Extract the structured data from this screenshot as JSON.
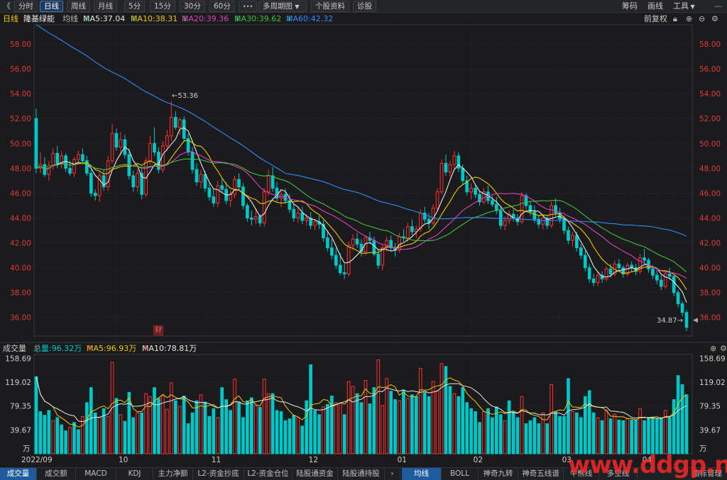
{
  "toolbar": {
    "back_glyph": "《",
    "periods": [
      "分时",
      "日线",
      "周线",
      "月线",
      "5分",
      "15分",
      "30分",
      "60分"
    ],
    "active_period": "日线",
    "more_glyph": "•••",
    "multi_period": "多周期图",
    "profile": "个股资料",
    "diagnose": "诊股",
    "right": [
      "筹码",
      "画线",
      "工具"
    ]
  },
  "info": {
    "period": "日线",
    "name": "隆基绿能",
    "ma_label": "均线",
    "ma": [
      {
        "text": "MA5:37.04",
        "arrow": "↓",
        "color": "#e8e8e8",
        "arrow_color": "#2ec27e"
      },
      {
        "text": "MA10:38.31",
        "arrow": "↓",
        "color": "#f0c800",
        "arrow_color": "#2ec27e"
      },
      {
        "text": "MA20:39.36",
        "arrow": "↓",
        "color": "#e040c0",
        "arrow_color": "#2ec27e"
      },
      {
        "text": "MA30:39.62",
        "arrow": "↓",
        "color": "#40c040",
        "arrow_color": "#2ec27e"
      },
      {
        "text": "MA60:42.32",
        "arrow": "↓",
        "color": "#2a8cff",
        "arrow_color": "#2ec27e"
      }
    ],
    "adjust": "前复权"
  },
  "price_axis": {
    "labels": [
      "58.00",
      "56.00",
      "54.00",
      "52.00",
      "50.00",
      "48.00",
      "46.00",
      "44.00",
      "42.00",
      "40.00",
      "38.00",
      "36.00"
    ],
    "min": 34.5,
    "max": 58.8
  },
  "high_marker": "53.36",
  "low_marker": "34.87",
  "fin_badge": "财",
  "volume": {
    "label": "成交量",
    "total": "总量:96.32万",
    "total_arrow": "↑",
    "ma5": "MA5:96.93万",
    "ma5_arrow": "↑",
    "ma10": "MA10:78.81万",
    "ma10_arrow": "↑",
    "axis": [
      "158.69",
      "119.02",
      "79.35",
      "39.67"
    ],
    "unit": "万",
    "max": 165
  },
  "x_axis": [
    "2022/09",
    "10",
    "11",
    "12",
    "01",
    "02",
    "03",
    "04"
  ],
  "bottom_tabs_left": [
    "成交量",
    "成交额",
    "MACD",
    "KDJ",
    "主力净额",
    "L2-资金抄底",
    "L2-资金仓位",
    "陆股通资金",
    "陆股通持股"
  ],
  "bottom_tabs_right": [
    "均线",
    "BOLL",
    "神奇九转",
    "神奇五线谱",
    "牛熊线",
    "多空线"
  ],
  "bottom_right": "指标管理",
  "watermark": "www.ddgp.net",
  "colors": {
    "up": "#ff3030",
    "down": "#00c8c8",
    "ma5": "#e8e8e8",
    "ma10": "#f0c800",
    "ma20": "#e040c0",
    "ma30": "#40c040",
    "ma60": "#2a8cff",
    "text_red": "#e03a3a"
  },
  "chart_data": {
    "type": "candlestick",
    "title": "隆基绿能",
    "note": "Daily candlesticks (前复权), approximately read from the screenshot",
    "candles": [
      [
        52.0,
        52.8,
        47.6,
        48.0
      ],
      [
        48.0,
        49.3,
        47.6,
        48.3
      ],
      [
        48.3,
        48.9,
        47.3,
        47.5
      ],
      [
        47.5,
        48.6,
        47.0,
        48.2
      ],
      [
        48.2,
        49.6,
        47.9,
        49.2
      ],
      [
        49.2,
        49.8,
        48.0,
        48.4
      ],
      [
        48.4,
        49.4,
        48.0,
        49.0
      ],
      [
        49.0,
        49.2,
        47.7,
        48.0
      ],
      [
        48.0,
        48.6,
        47.4,
        47.6
      ],
      [
        47.6,
        48.9,
        47.3,
        48.7
      ],
      [
        48.7,
        49.4,
        48.3,
        49.1
      ],
      [
        49.1,
        49.6,
        48.4,
        48.6
      ],
      [
        48.6,
        49.0,
        47.4,
        47.6
      ],
      [
        47.6,
        47.9,
        45.7,
        46.0
      ],
      [
        46.0,
        46.3,
        45.4,
        45.8
      ],
      [
        45.8,
        47.7,
        45.3,
        47.4
      ],
      [
        47.4,
        47.9,
        46.2,
        46.5
      ],
      [
        46.5,
        49.0,
        46.2,
        48.6
      ],
      [
        48.6,
        51.6,
        48.4,
        50.8
      ],
      [
        50.8,
        51.2,
        49.4,
        49.7
      ],
      [
        49.7,
        50.9,
        49.0,
        50.3
      ],
      [
        50.3,
        50.7,
        48.8,
        49.1
      ],
      [
        49.1,
        49.6,
        47.1,
        47.4
      ],
      [
        47.4,
        47.8,
        46.1,
        46.5
      ],
      [
        46.5,
        47.9,
        46.1,
        47.6
      ],
      [
        47.6,
        48.1,
        45.5,
        45.9
      ],
      [
        45.9,
        48.9,
        45.7,
        48.6
      ],
      [
        48.6,
        50.6,
        48.3,
        50.0
      ],
      [
        50.0,
        51.3,
        49.0,
        49.3
      ],
      [
        49.3,
        49.7,
        47.6,
        47.9
      ],
      [
        47.9,
        50.2,
        47.6,
        49.8
      ],
      [
        49.8,
        51.1,
        49.4,
        50.6
      ],
      [
        50.6,
        53.4,
        50.2,
        52.1
      ],
      [
        52.1,
        52.6,
        51.1,
        51.3
      ],
      [
        51.3,
        52.1,
        50.7,
        51.9
      ],
      [
        51.9,
        52.2,
        50.1,
        50.4
      ],
      [
        50.4,
        50.8,
        49.0,
        49.3
      ],
      [
        49.3,
        49.7,
        47.6,
        47.9
      ],
      [
        47.9,
        48.4,
        46.6,
        46.9
      ],
      [
        46.9,
        47.9,
        46.4,
        47.5
      ],
      [
        47.5,
        47.8,
        46.1,
        46.4
      ],
      [
        46.4,
        46.8,
        45.4,
        45.7
      ],
      [
        45.7,
        46.4,
        44.9,
        45.2
      ],
      [
        45.2,
        47.0,
        44.9,
        46.6
      ],
      [
        46.6,
        47.2,
        46.0,
        46.3
      ],
      [
        46.3,
        46.9,
        45.1,
        45.4
      ],
      [
        45.4,
        46.2,
        44.9,
        45.9
      ],
      [
        45.9,
        47.4,
        45.6,
        47.1
      ],
      [
        47.1,
        47.6,
        46.2,
        46.5
      ],
      [
        46.5,
        46.8,
        44.7,
        45.0
      ],
      [
        45.0,
        45.2,
        43.7,
        44.0
      ],
      [
        44.0,
        44.6,
        43.4,
        43.9
      ],
      [
        43.9,
        44.6,
        43.5,
        44.1
      ],
      [
        44.1,
        44.3,
        43.3,
        43.6
      ],
      [
        43.6,
        46.4,
        43.3,
        46.1
      ],
      [
        46.1,
        47.9,
        45.8,
        47.4
      ],
      [
        47.4,
        48.1,
        46.1,
        46.4
      ],
      [
        46.4,
        46.9,
        45.3,
        45.6
      ],
      [
        45.6,
        46.2,
        44.9,
        45.9
      ],
      [
        45.9,
        46.4,
        45.1,
        45.4
      ],
      [
        45.4,
        45.9,
        44.4,
        44.7
      ],
      [
        44.7,
        45.1,
        43.7,
        44.0
      ],
      [
        44.0,
        44.8,
        43.6,
        44.4
      ],
      [
        44.4,
        44.9,
        43.5,
        43.8
      ],
      [
        43.8,
        44.3,
        43.4,
        44.0
      ],
      [
        44.0,
        44.5,
        43.1,
        43.4
      ],
      [
        43.4,
        43.9,
        43.0,
        43.7
      ],
      [
        43.7,
        44.2,
        43.1,
        43.5
      ],
      [
        43.5,
        43.8,
        42.1,
        42.4
      ],
      [
        42.4,
        43.0,
        41.3,
        41.6
      ],
      [
        41.6,
        42.3,
        40.7,
        41.0
      ],
      [
        41.0,
        41.6,
        39.9,
        40.2
      ],
      [
        40.2,
        41.2,
        39.4,
        39.6
      ],
      [
        39.6,
        40.3,
        39.1,
        39.5
      ],
      [
        39.5,
        42.1,
        39.3,
        41.8
      ],
      [
        41.8,
        42.7,
        41.4,
        42.3
      ],
      [
        42.3,
        42.8,
        41.6,
        41.9
      ],
      [
        41.9,
        42.3,
        40.9,
        41.3
      ],
      [
        41.3,
        42.6,
        41.0,
        42.4
      ],
      [
        42.4,
        42.9,
        41.9,
        42.2
      ],
      [
        42.2,
        42.5,
        40.9,
        41.1
      ],
      [
        41.1,
        41.5,
        39.9,
        40.2
      ],
      [
        40.2,
        41.9,
        39.8,
        41.6
      ],
      [
        41.6,
        42.5,
        41.3,
        42.2
      ],
      [
        42.2,
        42.6,
        41.3,
        41.6
      ],
      [
        41.6,
        42.0,
        40.9,
        41.4
      ],
      [
        41.4,
        42.8,
        41.2,
        42.5
      ],
      [
        42.5,
        43.1,
        42.1,
        42.4
      ],
      [
        42.4,
        43.6,
        42.1,
        43.3
      ],
      [
        43.3,
        43.9,
        42.6,
        42.9
      ],
      [
        42.9,
        43.4,
        42.4,
        43.1
      ],
      [
        43.1,
        44.7,
        42.9,
        44.4
      ],
      [
        44.4,
        44.9,
        43.6,
        43.9
      ],
      [
        43.9,
        44.4,
        43.1,
        43.6
      ],
      [
        43.6,
        45.1,
        43.4,
        44.8
      ],
      [
        44.8,
        46.4,
        44.6,
        46.1
      ],
      [
        46.1,
        48.7,
        45.9,
        48.4
      ],
      [
        48.4,
        49.1,
        47.4,
        47.7
      ],
      [
        47.7,
        48.6,
        47.3,
        48.3
      ],
      [
        48.3,
        49.4,
        47.9,
        49.0
      ],
      [
        49.0,
        49.3,
        47.7,
        48.0
      ],
      [
        48.0,
        48.3,
        46.7,
        47.0
      ],
      [
        47.0,
        47.4,
        45.8,
        46.1
      ],
      [
        46.1,
        46.8,
        45.5,
        46.4
      ],
      [
        46.4,
        46.7,
        45.6,
        45.9
      ],
      [
        45.9,
        46.2,
        45.0,
        45.3
      ],
      [
        45.3,
        46.4,
        45.1,
        46.1
      ],
      [
        46.1,
        46.6,
        45.1,
        45.4
      ],
      [
        45.4,
        45.8,
        44.9,
        45.1
      ],
      [
        45.1,
        45.7,
        44.3,
        44.6
      ],
      [
        44.6,
        44.9,
        43.1,
        43.4
      ],
      [
        43.4,
        44.1,
        43.0,
        43.8
      ],
      [
        43.8,
        44.6,
        43.5,
        44.3
      ],
      [
        44.3,
        44.7,
        43.7,
        44.0
      ],
      [
        44.0,
        44.3,
        43.4,
        43.7
      ],
      [
        43.7,
        46.1,
        43.5,
        45.8
      ],
      [
        45.8,
        46.0,
        44.7,
        45.0
      ],
      [
        45.0,
        45.3,
        44.2,
        44.5
      ],
      [
        44.5,
        45.0,
        43.6,
        43.9
      ],
      [
        43.9,
        44.2,
        43.2,
        43.5
      ],
      [
        43.5,
        44.3,
        43.1,
        44.0
      ],
      [
        44.0,
        44.2,
        43.1,
        43.4
      ],
      [
        43.4,
        45.3,
        43.2,
        45.0
      ],
      [
        45.0,
        45.6,
        44.1,
        44.4
      ],
      [
        44.4,
        44.8,
        43.6,
        43.9
      ],
      [
        43.9,
        44.2,
        42.7,
        43.0
      ],
      [
        43.0,
        43.3,
        41.9,
        42.2
      ],
      [
        42.2,
        42.9,
        41.7,
        42.6
      ],
      [
        42.6,
        42.9,
        41.3,
        41.6
      ],
      [
        41.6,
        41.9,
        40.7,
        41.0
      ],
      [
        41.0,
        41.4,
        39.7,
        40.0
      ],
      [
        40.0,
        40.3,
        38.8,
        39.1
      ],
      [
        39.1,
        39.5,
        38.5,
        38.8
      ],
      [
        38.8,
        39.7,
        38.5,
        39.4
      ],
      [
        39.4,
        39.7,
        38.8,
        39.1
      ],
      [
        39.1,
        40.1,
        38.9,
        39.9
      ],
      [
        39.9,
        40.3,
        39.2,
        39.5
      ],
      [
        39.5,
        40.6,
        39.3,
        40.3
      ],
      [
        40.3,
        40.7,
        39.7,
        40.0
      ],
      [
        40.0,
        40.2,
        39.2,
        39.5
      ],
      [
        39.5,
        40.4,
        39.3,
        40.2
      ],
      [
        40.2,
        40.5,
        39.7,
        40.0
      ],
      [
        40.0,
        40.3,
        39.4,
        39.7
      ],
      [
        39.7,
        41.1,
        39.5,
        40.8
      ],
      [
        40.8,
        41.5,
        40.3,
        40.6
      ],
      [
        40.6,
        40.8,
        39.6,
        39.9
      ],
      [
        39.9,
        40.2,
        39.1,
        39.4
      ],
      [
        39.4,
        39.8,
        38.7,
        39.0
      ],
      [
        39.0,
        39.4,
        38.2,
        38.5
      ],
      [
        38.5,
        39.7,
        38.3,
        39.5
      ],
      [
        39.5,
        40.0,
        39.0,
        39.3
      ],
      [
        39.3,
        39.4,
        37.7,
        38.0
      ],
      [
        38.0,
        38.2,
        36.8,
        37.1
      ],
      [
        37.1,
        37.3,
        36.1,
        36.4
      ],
      [
        36.4,
        36.6,
        34.9,
        35.2
      ]
    ],
    "volumes": [
      [
        128,
        0
      ],
      [
        70,
        0
      ],
      [
        64,
        0
      ],
      [
        72,
        0
      ],
      [
        55,
        1
      ],
      [
        60,
        0
      ],
      [
        48,
        0
      ],
      [
        38,
        0
      ],
      [
        44,
        1
      ],
      [
        52,
        0
      ],
      [
        40,
        0
      ],
      [
        62,
        1
      ],
      [
        85,
        0
      ],
      [
        110,
        0
      ],
      [
        68,
        0
      ],
      [
        60,
        1
      ],
      [
        75,
        0
      ],
      [
        62,
        1
      ],
      [
        152,
        1
      ],
      [
        92,
        0
      ],
      [
        65,
        1
      ],
      [
        54,
        0
      ],
      [
        102,
        0
      ],
      [
        60,
        0
      ],
      [
        68,
        1
      ],
      [
        68,
        0
      ],
      [
        100,
        1
      ],
      [
        95,
        1
      ],
      [
        110,
        0
      ],
      [
        92,
        0
      ],
      [
        96,
        1
      ],
      [
        74,
        1
      ],
      [
        118,
        1
      ],
      [
        88,
        0
      ],
      [
        79,
        1
      ],
      [
        96,
        0
      ],
      [
        50,
        0
      ],
      [
        68,
        0
      ],
      [
        88,
        0
      ],
      [
        98,
        1
      ],
      [
        86,
        0
      ],
      [
        62,
        0
      ],
      [
        75,
        0
      ],
      [
        60,
        1
      ],
      [
        110,
        0
      ],
      [
        90,
        0
      ],
      [
        72,
        0
      ],
      [
        124,
        1
      ],
      [
        86,
        0
      ],
      [
        60,
        0
      ],
      [
        88,
        0
      ],
      [
        93,
        0
      ],
      [
        80,
        1
      ],
      [
        77,
        0
      ],
      [
        124,
        1
      ],
      [
        100,
        1
      ],
      [
        100,
        0
      ],
      [
        72,
        0
      ],
      [
        70,
        0
      ],
      [
        55,
        0
      ],
      [
        58,
        0
      ],
      [
        64,
        0
      ],
      [
        60,
        1
      ],
      [
        46,
        0
      ],
      [
        88,
        0
      ],
      [
        148,
        0
      ],
      [
        72,
        0
      ],
      [
        65,
        0
      ],
      [
        78,
        1
      ],
      [
        82,
        0
      ],
      [
        96,
        0
      ],
      [
        85,
        1
      ],
      [
        84,
        1
      ],
      [
        65,
        0
      ],
      [
        120,
        1
      ],
      [
        112,
        1
      ],
      [
        100,
        0
      ],
      [
        85,
        0
      ],
      [
        122,
        1
      ],
      [
        83,
        0
      ],
      [
        110,
        0
      ],
      [
        156,
        1
      ],
      [
        80,
        1
      ],
      [
        125,
        1
      ],
      [
        104,
        0
      ],
      [
        90,
        0
      ],
      [
        88,
        1
      ],
      [
        105,
        0
      ],
      [
        92,
        1
      ],
      [
        98,
        0
      ],
      [
        95,
        0
      ],
      [
        142,
        1
      ],
      [
        102,
        0
      ],
      [
        95,
        0
      ],
      [
        120,
        1
      ],
      [
        105,
        1
      ],
      [
        150,
        1
      ],
      [
        145,
        0
      ],
      [
        112,
        0
      ],
      [
        100,
        1
      ],
      [
        95,
        0
      ],
      [
        110,
        0
      ],
      [
        85,
        0
      ],
      [
        75,
        0
      ],
      [
        70,
        0
      ],
      [
        52,
        0
      ],
      [
        70,
        1
      ],
      [
        75,
        0
      ],
      [
        60,
        0
      ],
      [
        78,
        0
      ],
      [
        65,
        0
      ],
      [
        55,
        1
      ],
      [
        88,
        0
      ],
      [
        70,
        0
      ],
      [
        60,
        0
      ],
      [
        95,
        1
      ],
      [
        50,
        0
      ],
      [
        55,
        0
      ],
      [
        60,
        0
      ],
      [
        50,
        0
      ],
      [
        68,
        1
      ],
      [
        50,
        0
      ],
      [
        115,
        1
      ],
      [
        70,
        0
      ],
      [
        62,
        0
      ],
      [
        62,
        0
      ],
      [
        125,
        0
      ],
      [
        70,
        1
      ],
      [
        68,
        0
      ],
      [
        60,
        0
      ],
      [
        95,
        0
      ],
      [
        105,
        0
      ],
      [
        68,
        0
      ],
      [
        60,
        1
      ],
      [
        55,
        0
      ],
      [
        72,
        1
      ],
      [
        58,
        0
      ],
      [
        66,
        1
      ],
      [
        56,
        0
      ],
      [
        55,
        0
      ],
      [
        58,
        1
      ],
      [
        56,
        0
      ],
      [
        56,
        0
      ],
      [
        75,
        1
      ],
      [
        55,
        0
      ],
      [
        60,
        0
      ],
      [
        60,
        0
      ],
      [
        58,
        0
      ],
      [
        60,
        0
      ],
      [
        72,
        1
      ],
      [
        60,
        0
      ],
      [
        90,
        0
      ],
      [
        130,
        0
      ],
      [
        115,
        0
      ],
      [
        98,
        0
      ]
    ],
    "ma60_start": 58.3,
    "y_range": [
      34.5,
      58.8
    ]
  }
}
